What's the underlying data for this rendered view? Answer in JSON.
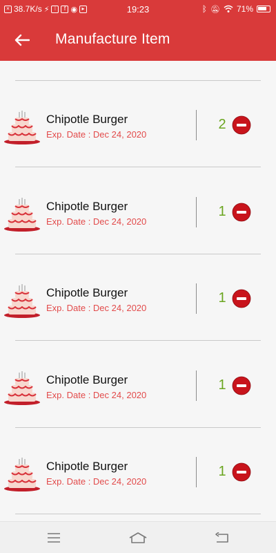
{
  "status_bar": {
    "speed": "38.7K/s",
    "time": "19:23",
    "battery_pct": "71%"
  },
  "app_bar": {
    "title": "Manufacture Item"
  },
  "items": [
    {
      "name": "Chipotle Burger",
      "exp": "Exp. Date : Dec 24, 2020",
      "qty": "2"
    },
    {
      "name": "Chipotle Burger",
      "exp": "Exp. Date : Dec 24, 2020",
      "qty": "1"
    },
    {
      "name": "Chipotle Burger",
      "exp": "Exp. Date : Dec 24, 2020",
      "qty": "1"
    },
    {
      "name": "Chipotle Burger",
      "exp": "Exp. Date : Dec 24, 2020",
      "qty": "1"
    },
    {
      "name": "Chipotle Burger",
      "exp": "Exp. Date : Dec 24, 2020",
      "qty": "1"
    }
  ],
  "colors": {
    "primary": "#d93a3a",
    "quantity": "#6aa51f",
    "exp_date": "#e24a4a",
    "remove": "#c8141c"
  },
  "icons": {
    "back": "back-arrow-icon",
    "remove": "minus-circle-icon",
    "item": "cake-icon",
    "nav_menu": "menu-icon",
    "nav_home": "home-icon",
    "nav_back": "return-icon"
  }
}
